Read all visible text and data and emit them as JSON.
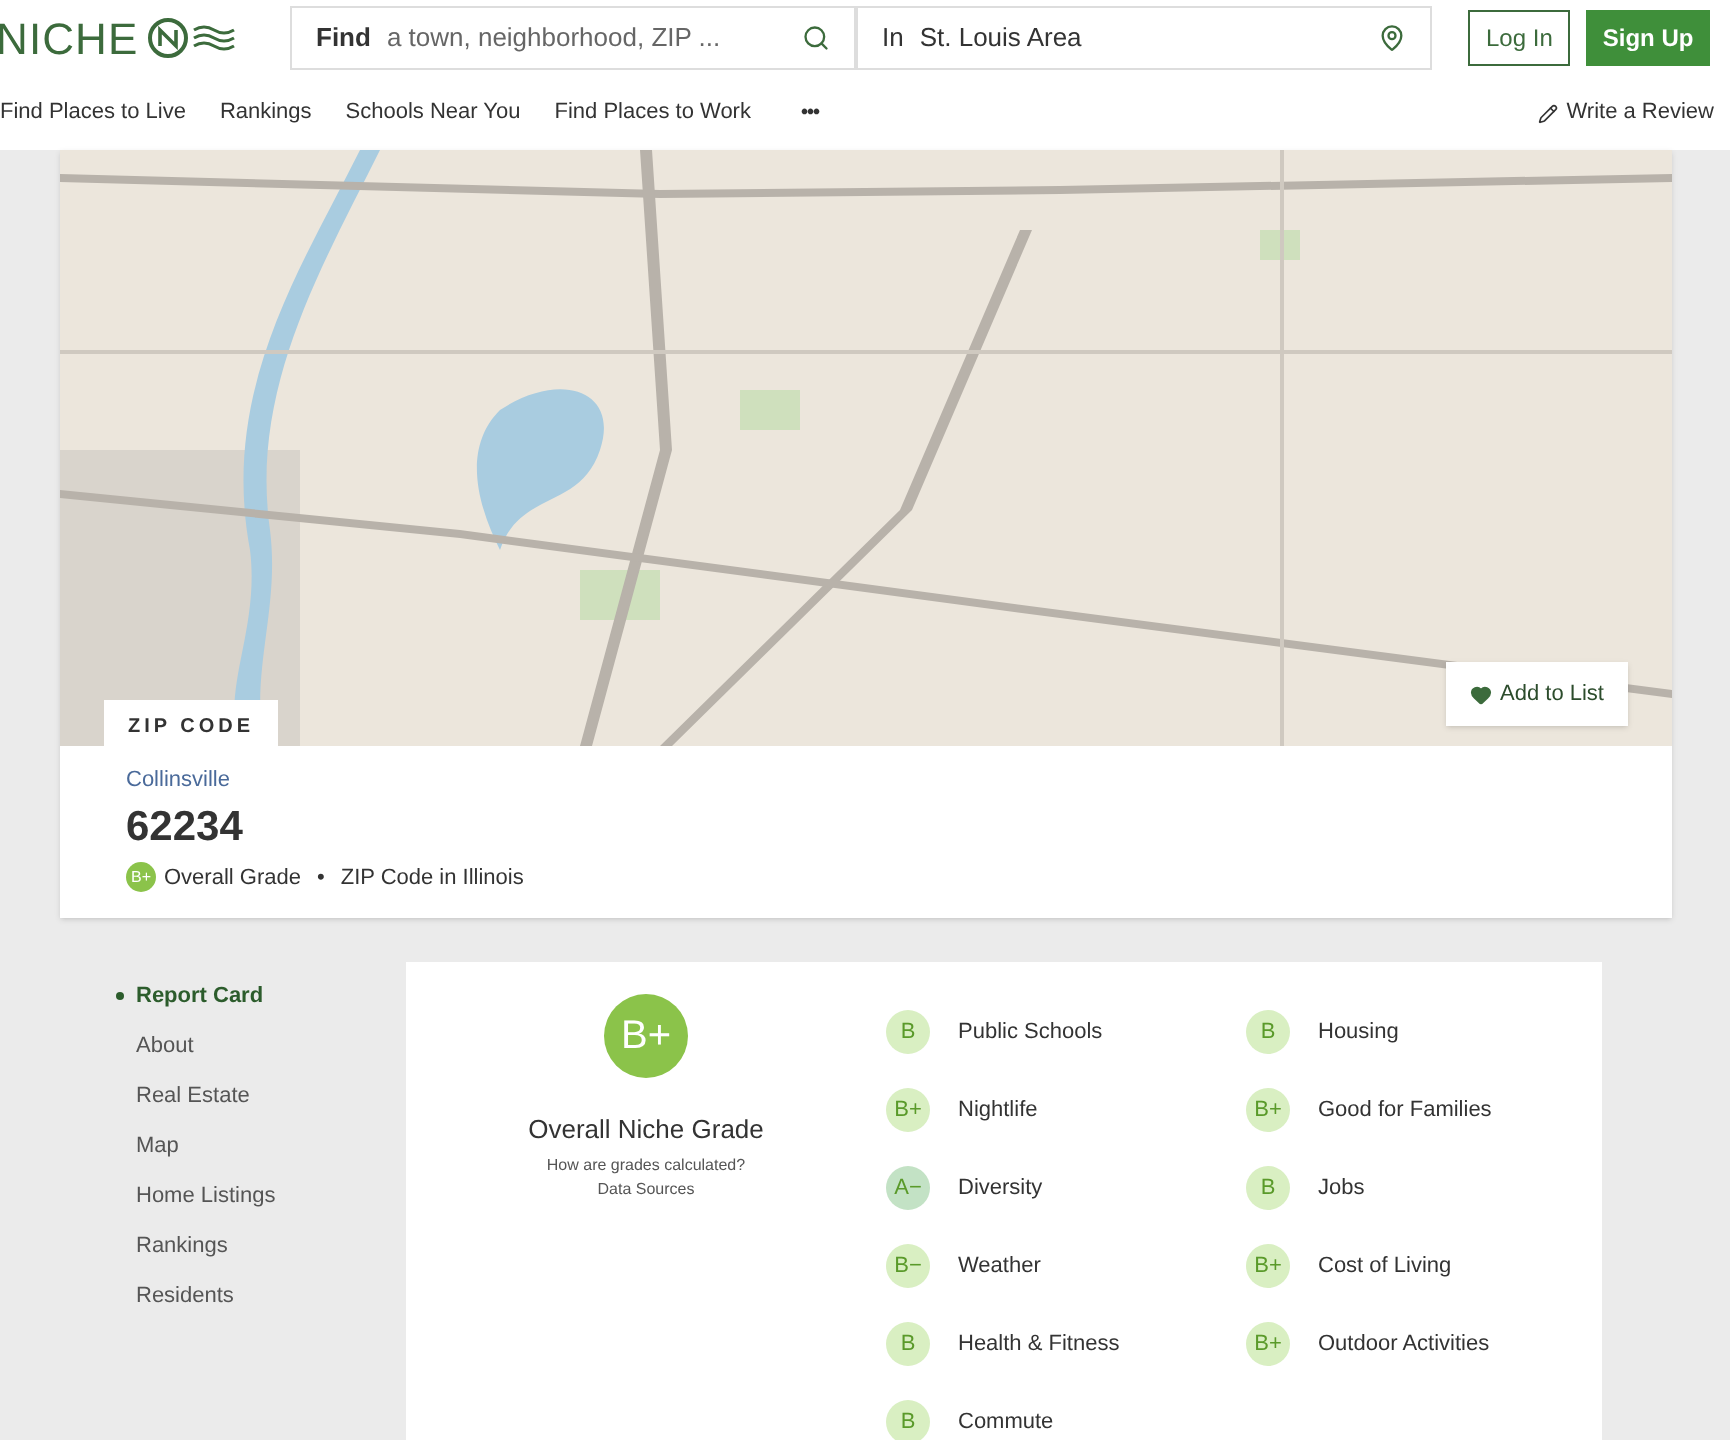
{
  "header": {
    "logo": "NICHE",
    "search": {
      "label": "Find",
      "placeholder": "a town, neighborhood, ZIP ..."
    },
    "location": {
      "label": "In",
      "value": "St. Louis Area"
    },
    "login": "Log In",
    "signup": "Sign Up"
  },
  "nav": {
    "items": [
      "Find Places to Live",
      "Rankings",
      "Schools Near You",
      "Find Places to Work"
    ],
    "more": "•••",
    "review": "Write a Review"
  },
  "map": {
    "badge": "ZIP CODE",
    "add_to_list": "Add to List"
  },
  "place": {
    "city": "Collinsville",
    "zip": "62234",
    "grade": "B+",
    "grade_label": "Overall Grade",
    "separator": "•",
    "type": "ZIP Code in Illinois"
  },
  "sidebar": {
    "items": [
      {
        "label": "Report Card",
        "selected": true
      },
      {
        "label": "About",
        "selected": false
      },
      {
        "label": "Real Estate",
        "selected": false
      },
      {
        "label": "Map",
        "selected": false
      },
      {
        "label": "Home Listings",
        "selected": false
      },
      {
        "label": "Rankings",
        "selected": false
      },
      {
        "label": "Residents",
        "selected": false
      }
    ]
  },
  "report_card": {
    "overall": {
      "grade": "B+",
      "title": "Overall Niche Grade",
      "link1": "How are grades calculated?",
      "link2": "Data Sources"
    },
    "grades": [
      {
        "grade": "B",
        "label": "Public Schools",
        "color": "#d9efc2"
      },
      {
        "grade": "B",
        "label": "Housing",
        "color": "#d9efc2"
      },
      {
        "grade": "B+",
        "label": "Nightlife",
        "color": "#d9efc2"
      },
      {
        "grade": "B+",
        "label": "Good for Families",
        "color": "#d9efc2"
      },
      {
        "grade": "A−",
        "label": "Diversity",
        "color": "#c3e2c5"
      },
      {
        "grade": "B",
        "label": "Jobs",
        "color": "#d9efc2"
      },
      {
        "grade": "B−",
        "label": "Weather",
        "color": "#d9efc2"
      },
      {
        "grade": "B+",
        "label": "Cost of Living",
        "color": "#d9efc2"
      },
      {
        "grade": "B",
        "label": "Health & Fitness",
        "color": "#d9efc2"
      },
      {
        "grade": "B+",
        "label": "Outdoor Activities",
        "color": "#d9efc2"
      },
      {
        "grade": "B",
        "label": "Commute",
        "color": "#d9efc2"
      }
    ]
  }
}
